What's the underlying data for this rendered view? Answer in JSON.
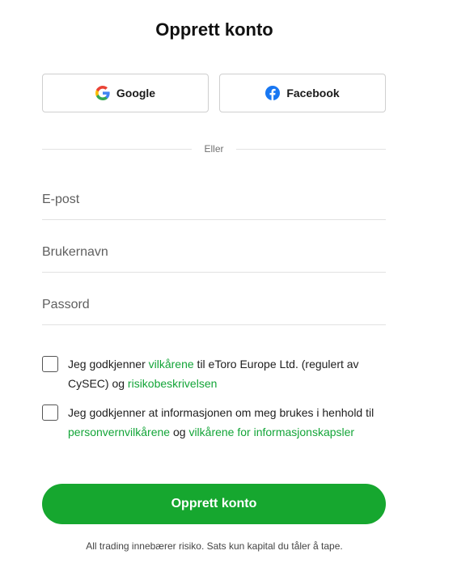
{
  "page": {
    "title": "Opprett konto"
  },
  "social": {
    "google_label": "Google",
    "facebook_label": "Facebook",
    "google_icon": "google-icon",
    "facebook_icon": "facebook-icon"
  },
  "divider": {
    "text": "Eller"
  },
  "form": {
    "email": {
      "placeholder": "E-post",
      "value": ""
    },
    "username": {
      "placeholder": "Brukernavn",
      "value": ""
    },
    "password": {
      "placeholder": "Passord",
      "value": ""
    }
  },
  "consents": [
    {
      "checked": false,
      "text_1": "Jeg godkjenner ",
      "link_1": "vilkårene",
      "text_2": " til eToro Europe Ltd. (regulert av CySEC) og ",
      "link_2": "risikobeskrivelsen",
      "text_3": ""
    },
    {
      "checked": false,
      "text_1": "Jeg godkjenner at informasjonen om meg brukes i henhold til ",
      "link_1": "personvernvilkårene",
      "text_2": " og ",
      "link_2": "vilkårene for informasjonskapsler",
      "text_3": ""
    }
  ],
  "submit_label": "Opprett konto",
  "disclaimer": "All trading innebærer risiko. Sats kun kapital du tåler å tape.",
  "colors": {
    "primary_green": "#16a72f",
    "link_green": "#13a538",
    "facebook_blue": "#1877f2"
  }
}
